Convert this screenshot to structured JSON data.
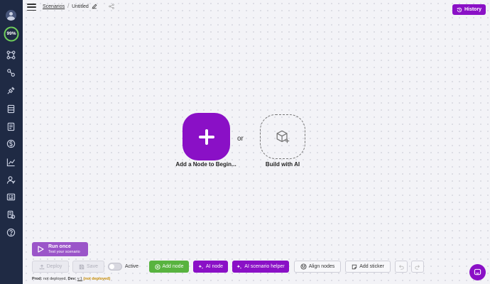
{
  "app": {
    "breadcrumb": {
      "root": "Scenarios",
      "separator": "/",
      "current": "Untitled"
    },
    "history_button": "History"
  },
  "sidebar": {
    "progress_label": "99%",
    "progress_value": 0.99,
    "items": [
      {
        "icon": "nodes-icon"
      },
      {
        "icon": "connections-icon"
      },
      {
        "icon": "plugin-icon"
      },
      {
        "icon": "datastore-icon"
      },
      {
        "icon": "templates-icon"
      },
      {
        "icon": "billing-icon"
      },
      {
        "icon": "analytics-icon"
      },
      {
        "icon": "team-icon"
      },
      {
        "icon": "list-icon"
      },
      {
        "icon": "news-icon"
      },
      {
        "icon": "coins-icon"
      },
      {
        "icon": "help-icon"
      }
    ]
  },
  "canvas": {
    "add_node_label": "Add a Node to Begin...",
    "or_text": "or",
    "build_ai_label": "Build with AI"
  },
  "bottom_bar": {
    "run_once_title": "Run once",
    "run_once_subtitle": "Test your scenario",
    "deploy": "Deploy",
    "save": "Save",
    "active_label": "Active",
    "active_on": false,
    "add_node": "Add node",
    "ai_node": "AI node",
    "ai_helper": "AI scenario helper",
    "align_nodes": "Align nodes",
    "add_sticker": "Add sticker"
  },
  "status": {
    "prod_label": "Prod:",
    "prod_value": "not deployed,",
    "dev_label": "Dev:",
    "dev_version": "v.1",
    "dev_state": "(not deployed)"
  },
  "colors": {
    "accent": "#8a10c6",
    "sidebar": "#1f2a44",
    "green": "#58b33f",
    "progress_ring": "#6fcf5a",
    "warning": "#c58a00"
  }
}
